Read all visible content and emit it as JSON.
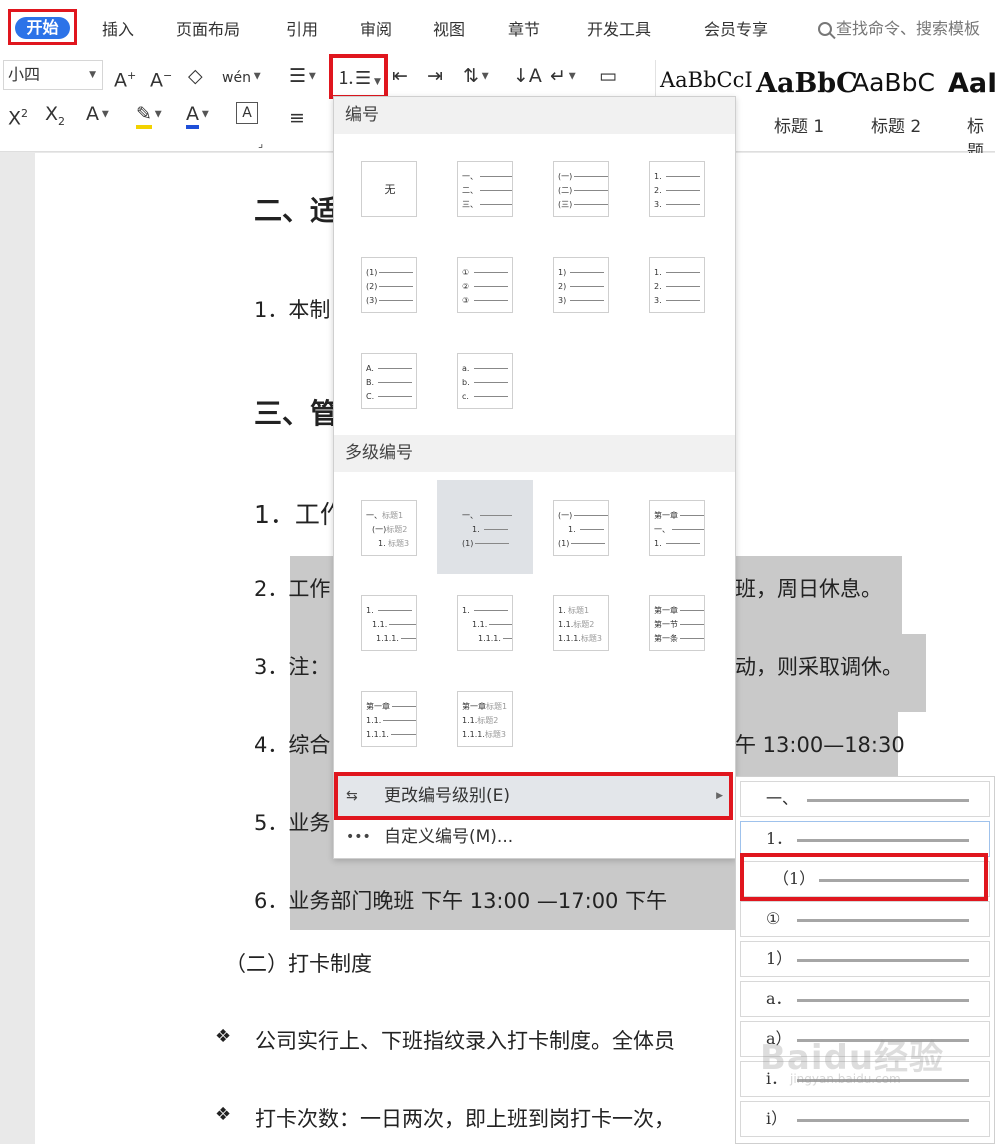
{
  "menubar": {
    "start": "开始",
    "items": [
      "插入",
      "页面布局",
      "引用",
      "审阅",
      "视图",
      "章节",
      "开发工具",
      "会员专享"
    ],
    "search_placeholder": "查找命令、搜索模板"
  },
  "ribbon": {
    "font_size": "小四",
    "pinyin_label": "wén",
    "style_samples": [
      "AaBbCcI",
      "AaBbC",
      "AaBbC",
      "AaI"
    ],
    "style_labels": [
      "标题 1",
      "标题 2",
      "标题"
    ]
  },
  "document": {
    "lines": [
      "二、适",
      "1．本制",
      "三、管",
      "1．工作",
      "2．工作",
      "班，周日休息。",
      "3．注：",
      "动，则采取调休。",
      "4．综合",
      "午 13:00—18:30",
      "5．业务",
      "6．业务部门晚班    下午 13:00 —17:00       下午",
      "（二）打卡制度",
      "公司实行上、下班指纹录入打卡制度。全体员",
      "打卡次数：一日两次，即上班到岗打卡一次，"
    ],
    "bullet": "❖"
  },
  "dropdown": {
    "section_numbering": "编号",
    "section_multilevel": "多级编号",
    "none_label": "无",
    "single_thumbs": [
      [
        "一、",
        "二、",
        "三、"
      ],
      [
        "(一)",
        "(二)",
        "(三)"
      ],
      [
        "1.",
        "2.",
        "3."
      ],
      [
        "(1)",
        "(2)",
        "(3)"
      ],
      [
        "①",
        "②",
        "③"
      ],
      [
        "1)",
        "2)",
        "3)"
      ],
      [
        "1.",
        "2.",
        "3."
      ],
      [
        "A.",
        "B.",
        "C."
      ],
      [
        "a.",
        "b.",
        "c."
      ]
    ],
    "multi_thumbs": [
      [
        [
          "一、",
          "标题1"
        ],
        [
          "(一)",
          "标题2"
        ],
        [
          "1.",
          "标题3"
        ]
      ],
      [
        [
          "一、",
          ""
        ],
        [
          "1.",
          ""
        ],
        [
          "(1)",
          ""
        ]
      ],
      [
        [
          "(一)",
          ""
        ],
        [
          "1.",
          ""
        ],
        [
          "(1)",
          ""
        ]
      ],
      [
        [
          "第一章",
          ""
        ],
        [
          "一、",
          ""
        ],
        [
          "1.",
          ""
        ]
      ],
      [
        [
          "1.",
          ""
        ],
        [
          "1.1.",
          ""
        ],
        [
          "1.1.1.",
          ""
        ]
      ],
      [
        [
          "1.",
          ""
        ],
        [
          "1.1.",
          ""
        ],
        [
          "1.1.1.",
          ""
        ]
      ],
      [
        [
          "1.",
          "标题1"
        ],
        [
          "1.1.",
          "标题2"
        ],
        [
          "1.1.1.",
          "标题3"
        ]
      ],
      [
        [
          "第一章",
          ""
        ],
        [
          "第一节",
          ""
        ],
        [
          "第一条",
          ""
        ]
      ],
      [
        [
          "第一章",
          ""
        ],
        [
          "1.1.",
          ""
        ],
        [
          "1.1.1.",
          ""
        ]
      ],
      [
        [
          "第一章",
          "标题1"
        ],
        [
          "1.1.",
          "标题2"
        ],
        [
          "1.1.1.",
          "标题3"
        ]
      ]
    ],
    "change_level": "更改编号级别(E)",
    "custom_numbering": "自定义编号(M)..."
  },
  "submenu": {
    "levels": [
      "一、",
      "1．",
      "（1）",
      "①",
      "1）",
      "a．",
      "a）",
      "i．",
      "i）"
    ],
    "selected_index": 2,
    "active_index": 1
  },
  "watermark": {
    "brand": "Baidu经验",
    "url": "jingyan.baidu.com"
  },
  "colors": {
    "accent_red": "#e0161e",
    "start_blue": "#2c73e8",
    "selection_gray": "#c9c9c9"
  }
}
